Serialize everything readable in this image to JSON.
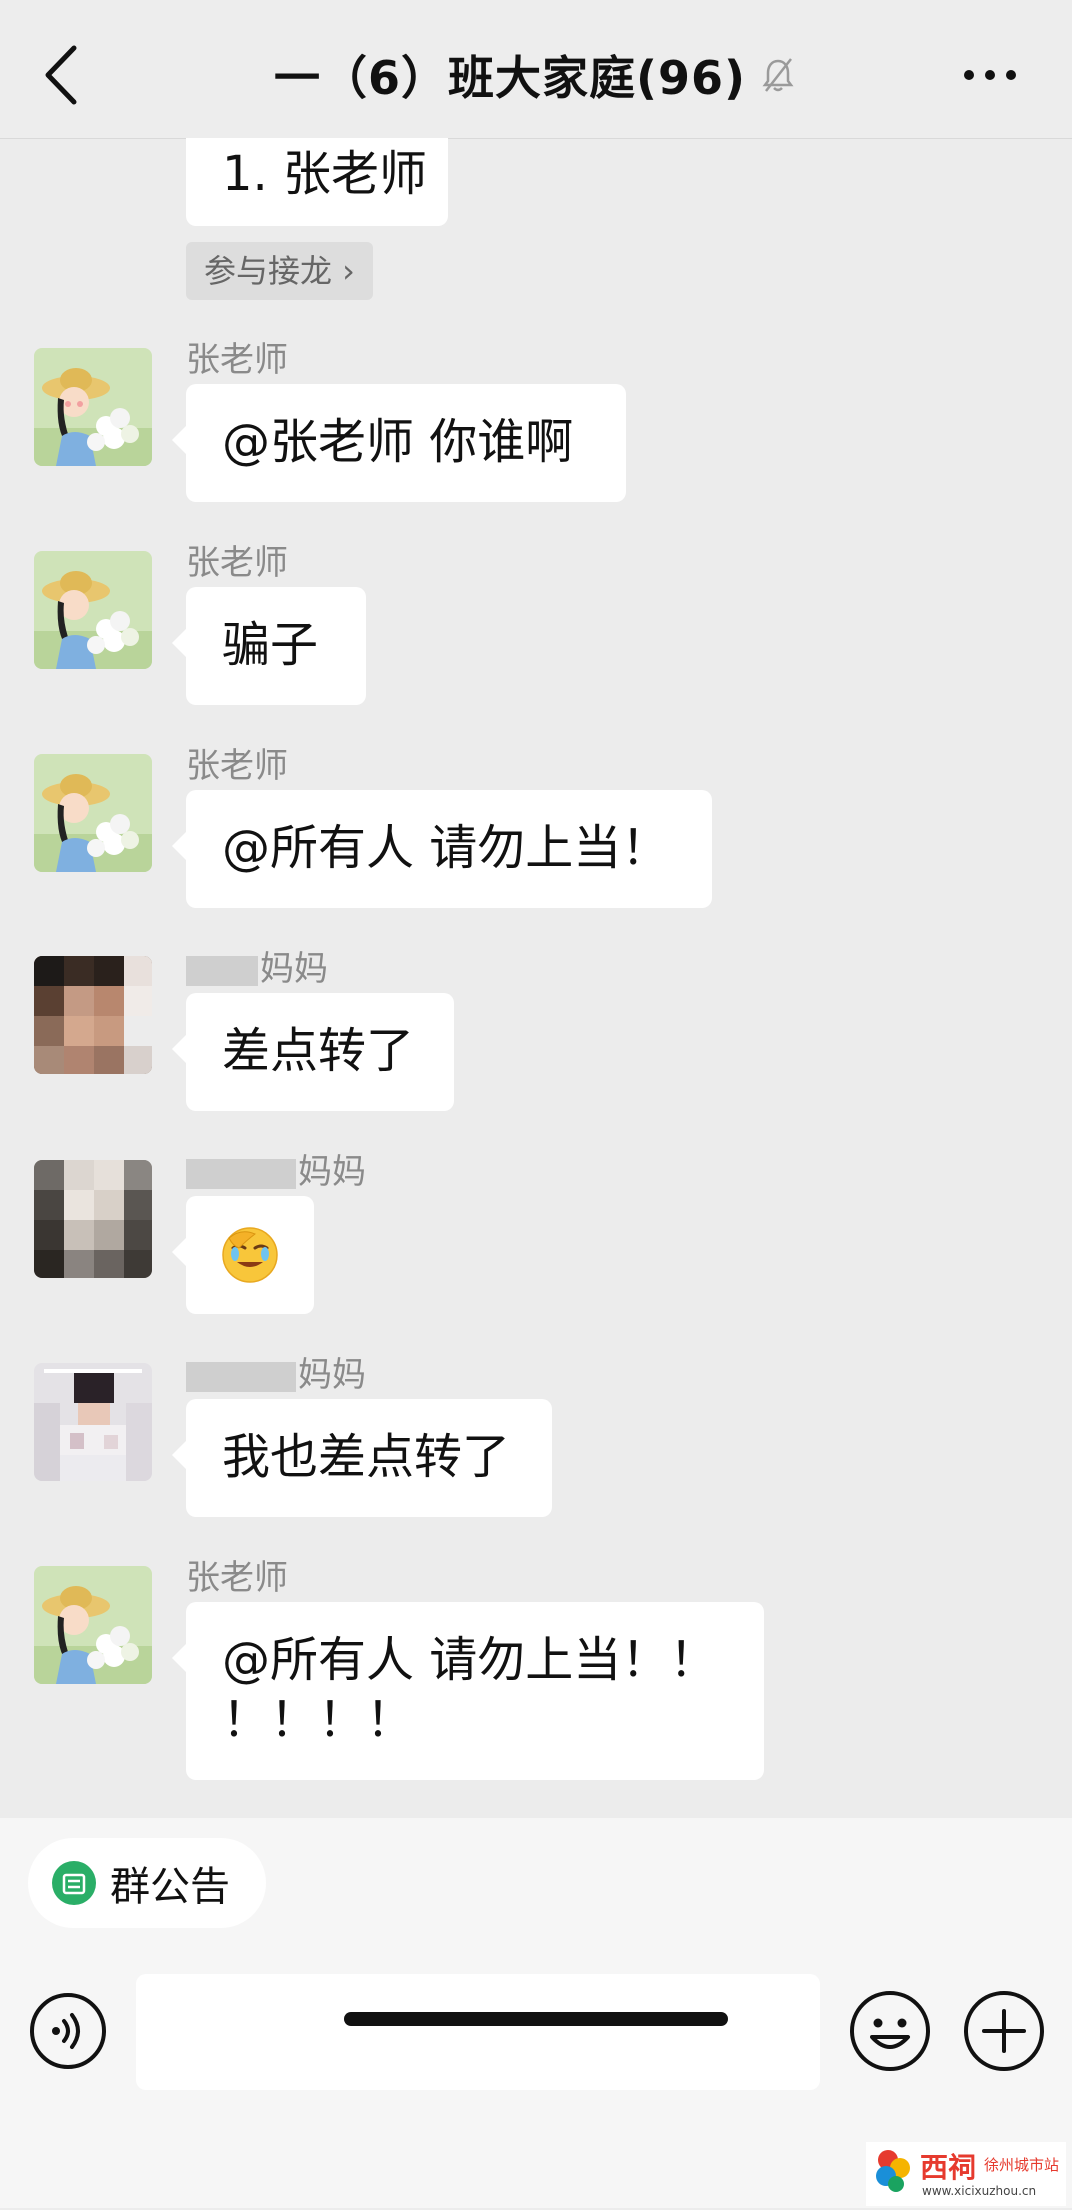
{
  "header": {
    "title": "一（6）班大家庭(96)",
    "back_icon": "chevron-left-icon",
    "mute_icon": "bell-muted-icon",
    "more_icon": "more-dots-icon"
  },
  "jielong": {
    "entry_text": "1. 张老师",
    "join_label": "参与接龙 ›"
  },
  "messages": [
    {
      "sender": "张老师",
      "text": "@张老师  你谁啊"
    },
    {
      "sender": "张老师",
      "text": "骗子"
    },
    {
      "sender": "张老师",
      "text": "@所有人  请勿上当！"
    },
    {
      "sender": "妈妈",
      "text": "差点转了"
    },
    {
      "sender": "妈妈",
      "text": "",
      "emoji": "facepalm-emoji"
    },
    {
      "sender": "妈妈",
      "text": "我也差点转了"
    },
    {
      "sender": "张老师",
      "text_line1": "@所有人  请勿上当！！",
      "text_line2": "！！！！"
    }
  ],
  "bottom": {
    "notice_label": "群公告",
    "input_placeholder": "",
    "icons": [
      "voice-icon",
      "emoji-icon",
      "plus-icon"
    ]
  },
  "watermark": {
    "brand": "西祠",
    "city": "徐州城市站",
    "url": "www.xicixuzhou.cn"
  },
  "colors": {
    "background": "#ececec",
    "bubble": "#ffffff",
    "accent_green": "#2aae67"
  }
}
